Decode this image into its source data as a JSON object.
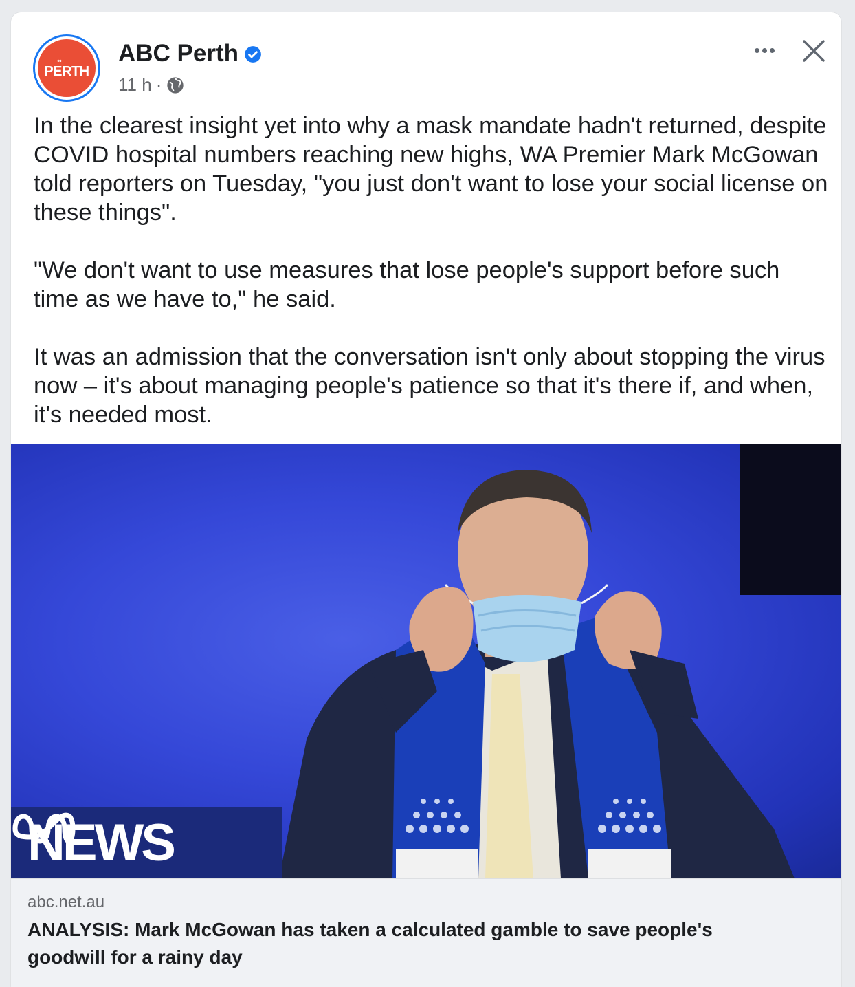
{
  "post": {
    "page_name": "ABC Perth",
    "avatar_text": "PERTH",
    "timestamp": "11 h",
    "separator": "·",
    "audience_icon": "globe-icon",
    "verified_icon": "verified-badge-icon",
    "paragraphs": [
      "In the clearest insight yet into why a mask mandate hadn't returned, despite COVID hospital numbers reaching new highs, WA Premier Mark McGowan told reporters on Tuesday, \"you just don't want to lose your social license on these things\".",
      "\"We don't want to use measures that lose people's support before such time as we have to,\" he said.",
      "It was an admission that the conversation isn't only about stopping the virus now – it's about managing people's patience so that it's there if, and when, it's needed most."
    ]
  },
  "image": {
    "watermark": "NEWS"
  },
  "link": {
    "domain": "abc.net.au",
    "title": "ANALYSIS: Mark McGowan has taken a calculated gamble to save people's goodwill for a rainy day"
  },
  "colors": {
    "accent": "#1877f2",
    "abc_red": "#ea4e36",
    "background_blue": "#3548d8"
  }
}
